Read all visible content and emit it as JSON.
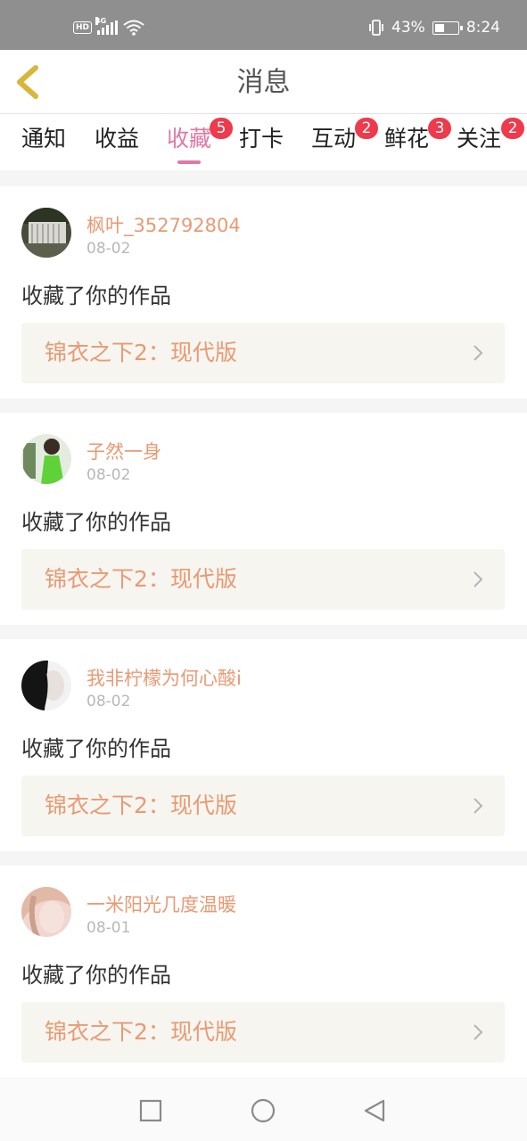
{
  "status_bar": {
    "hd": "HD",
    "network": "4G",
    "battery_percent_text": "43%",
    "battery_level": 0.43,
    "time": "8:24"
  },
  "header": {
    "title": "消息",
    "back_icon": "chevron-left-icon"
  },
  "tabs": [
    {
      "label": "通知",
      "badge": ""
    },
    {
      "label": "收益",
      "badge": ""
    },
    {
      "label": "收藏",
      "badge": "5",
      "active": true
    },
    {
      "label": "打卡",
      "badge": ""
    },
    {
      "label": "互动",
      "badge": "2"
    },
    {
      "label": "鲜花",
      "badge": "3"
    },
    {
      "label": "关注",
      "badge": "2"
    }
  ],
  "messages": [
    {
      "username": "枫叶_352792804",
      "date": "08-02",
      "action": "收藏了你的作品",
      "work_title": "锦衣之下2：现代版",
      "avatar": "waterfall-photo"
    },
    {
      "username": "子然一身",
      "date": "08-02",
      "action": "收藏了你的作品",
      "work_title": "锦衣之下2：现代版",
      "avatar": "green-dress-photo"
    },
    {
      "username": "我非柠檬为何心酸i",
      "date": "08-02",
      "action": "收藏了你的作品",
      "work_title": "锦衣之下2：现代版",
      "avatar": "dark-hair-photo"
    },
    {
      "username": "一米阳光几度温暖",
      "date": "08-01",
      "action": "收藏了你的作品",
      "work_title": "锦衣之下2：现代版",
      "avatar": "pink-portrait-photo"
    }
  ],
  "colors": {
    "accent": "#e277a6",
    "badge": "#ee3a4b",
    "username": "#e89a74",
    "work_bg": "#f6f5ef",
    "back_icon": "#d9b53a"
  }
}
